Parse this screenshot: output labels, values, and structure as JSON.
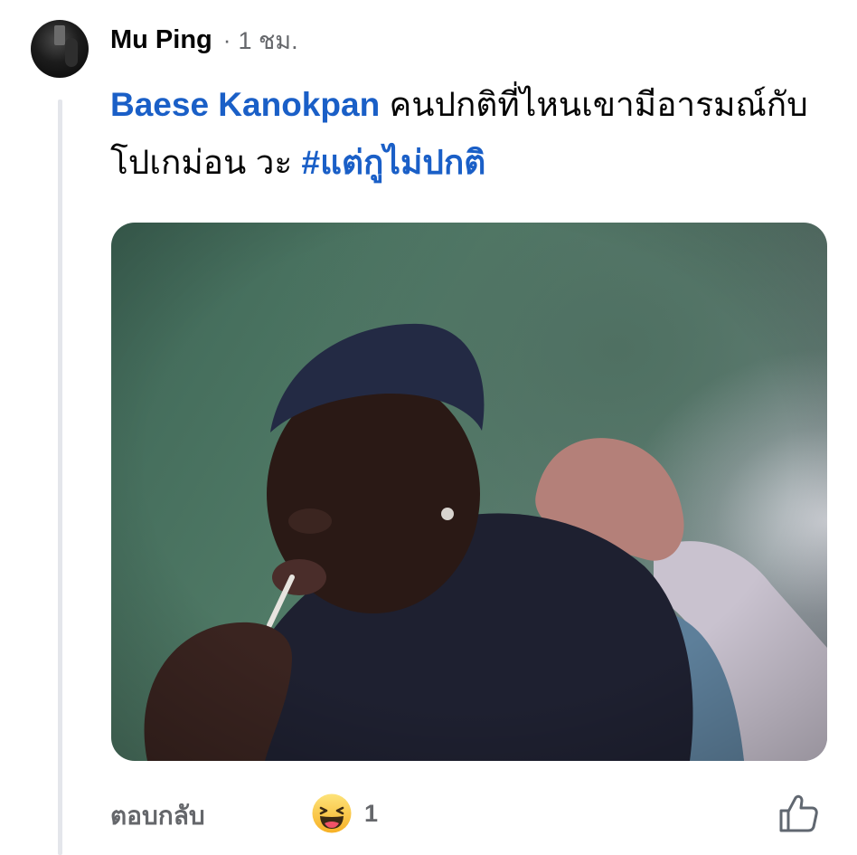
{
  "comment": {
    "author": "Mu Ping",
    "separator": "·",
    "time": "1 ชม.",
    "mention": "Baese Kanokpan",
    "body": "คนปกติที่ไหนเขามีอารมณ์กับ โปเกม่อน วะ",
    "hashtag": "#แต่กูไม่ปกติ",
    "avatar_icon": "user-avatar",
    "photo_icon": "comment-photo"
  },
  "actions": {
    "reply_label": "ตอบกลับ",
    "reaction_icon": "haha-emoji-icon",
    "reaction_count": "1",
    "like_icon": "thumbs-up-icon"
  },
  "colors": {
    "link_blue": "#1a5fc7",
    "secondary_text": "#65676b",
    "primary_text": "#050505",
    "thread_line": "#e4e6eb",
    "reaction_yellow": "#f7b125"
  }
}
